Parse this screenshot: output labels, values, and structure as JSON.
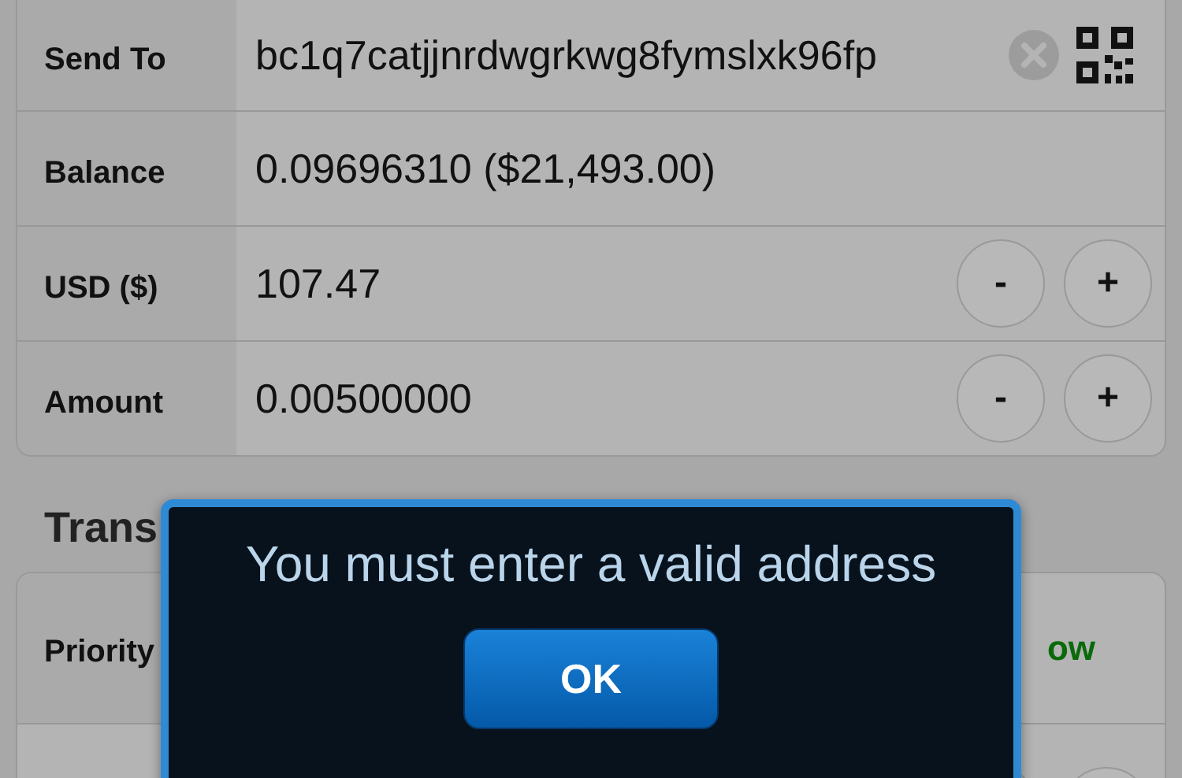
{
  "form": {
    "rows": [
      {
        "kind": "address",
        "label": "Send To",
        "value": "bc1q7catjjnrdwgrkwg8fymslxk96fp"
      },
      {
        "kind": "text",
        "label": "Balance",
        "value": "0.09696310 ($21,493.00)"
      },
      {
        "kind": "stepper",
        "label": "USD ($)",
        "value": "107.47",
        "minus": "-",
        "plus": "+"
      },
      {
        "kind": "stepper",
        "label": "Amount",
        "value": "0.00500000",
        "minus": "-",
        "plus": "+"
      }
    ]
  },
  "section": {
    "title": "Trans",
    "rows": [
      {
        "kind": "choice",
        "label": "Priority",
        "value": "ow"
      },
      {
        "kind": "stepper-hidden"
      }
    ]
  },
  "dialog": {
    "message": "You must enter a valid address",
    "button": "OK"
  }
}
